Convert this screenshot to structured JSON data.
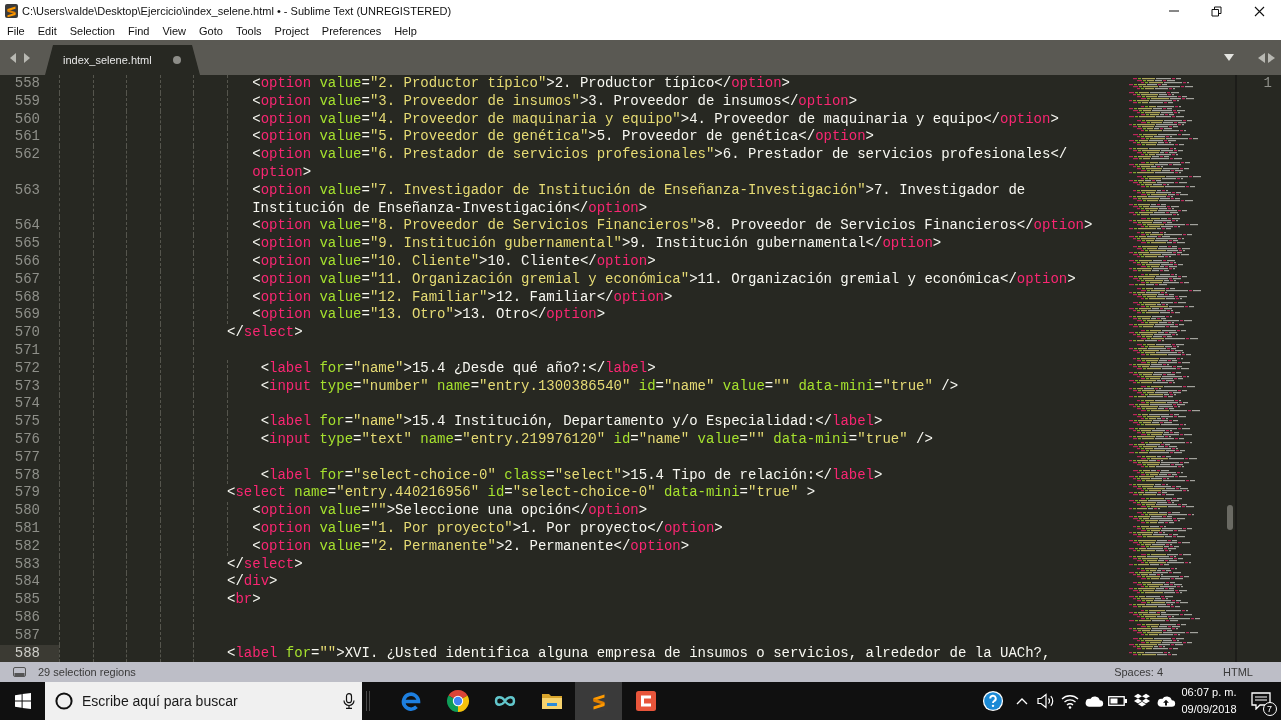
{
  "window": {
    "title": "C:\\Users\\valde\\Desktop\\Ejercicio\\index_selene.html • - Sublime Text (UNREGISTERED)"
  },
  "menu": [
    "File",
    "Edit",
    "Selection",
    "Find",
    "View",
    "Goto",
    "Tools",
    "Project",
    "Preferences",
    "Help"
  ],
  "tabs": [
    {
      "label": "index_selene.html",
      "selected": true,
      "modified": true
    }
  ],
  "editor": {
    "lines": [
      {
        "number": "558",
        "current": false,
        "rows": [
          "                       <option value=\"2. Productor típico\">2. Productor típico</option>"
        ]
      },
      {
        "number": "559",
        "current": false,
        "rows": [
          "                       <option value=\"3. Proveedor de insumos\">3. Proveedor de insumos</option>"
        ]
      },
      {
        "number": "560",
        "current": false,
        "rows": [
          "                       <option value=\"4. Proveedor de maquinaria y equipo\">4. Proveedor de maquinaria y equipo</option>"
        ]
      },
      {
        "number": "561",
        "current": false,
        "rows": [
          "                       <option value=\"5. Proveedor de genética\">5. Proveedor de genética</option>"
        ]
      },
      {
        "number": "562",
        "current": false,
        "rows": [
          "                       <option value=\"6. Prestador de servicios profesionales\">6. Prestador de servicios profesionales</",
          "option>"
        ]
      },
      {
        "number": "563",
        "current": false,
        "rows": [
          "                       <option value=\"7. Investigador de Institución de Enseñanza-Investigación\">7. Investigador de",
          "Institución de Enseñanza-Investigación</option>"
        ]
      },
      {
        "number": "564",
        "current": false,
        "rows": [
          "                       <option value=\"8. Proveedor de Servicios Financieros\">8. Proveedor de Servicios Financieros</option>"
        ]
      },
      {
        "number": "565",
        "current": false,
        "rows": [
          "                       <option value=\"9. Institución gubernamental\">9. Institución gubernamental</option>"
        ]
      },
      {
        "number": "566",
        "current": false,
        "rows": [
          "                       <option value=\"10. Cliente\">10. Cliente</option>"
        ]
      },
      {
        "number": "567",
        "current": false,
        "rows": [
          "                       <option value=\"11. Organización gremial y económica\">11. Organización gremial y económica</option>"
        ]
      },
      {
        "number": "568",
        "current": false,
        "rows": [
          "                       <option value=\"12. Familiar\">12. Familiar</option>"
        ]
      },
      {
        "number": "569",
        "current": false,
        "rows": [
          "                       <option value=\"13. Otro\">13. Otro</option>"
        ]
      },
      {
        "number": "570",
        "current": false,
        "rows": [
          "                    </select>"
        ]
      },
      {
        "number": "571",
        "current": false
      },
      {
        "number": "572",
        "current": false,
        "rows": [
          "                        <label for=\"name\">15.4 ¿Desde qué año?:</label>"
        ]
      },
      {
        "number": "573",
        "current": false,
        "rows": [
          "                        <input type=\"number\" name=\"entry.1300386540\" id=\"name\" value=\"\" data-mini=\"true\" />"
        ]
      },
      {
        "number": "574",
        "current": false
      },
      {
        "number": "575",
        "current": false,
        "rows": [
          "                        <label for=\"name\">15.4 Institución, Departamento y/o Especialidad:</label>"
        ]
      },
      {
        "number": "576",
        "current": false,
        "rows": [
          "                        <input type=\"text\" name=\"entry.219976120\" id=\"name\" value=\"\" data-mini=\"true\" />"
        ]
      },
      {
        "number": "577",
        "current": false
      },
      {
        "number": "578",
        "current": false,
        "rows": [
          "                        <label for=\"select-choice-0\" class=\"select\">15.4 Tipo de relación:</label>"
        ]
      },
      {
        "number": "579",
        "current": false,
        "rows": [
          "                    <select name=\"entry.440216956\" id=\"select-choice-0\" data-mini=\"true\" >"
        ]
      },
      {
        "number": "580",
        "current": false,
        "rows": [
          "                       <option value=\"\">Seleccione una opción</option>"
        ]
      },
      {
        "number": "581",
        "current": false,
        "rows": [
          "                       <option value=\"1. Por proyecto\">1. Por proyecto</option>"
        ]
      },
      {
        "number": "582",
        "current": false,
        "rows": [
          "                       <option value=\"2. Permanente\">2. Permanente</option>"
        ]
      },
      {
        "number": "583",
        "current": false,
        "rows": [
          "                    </select>"
        ]
      },
      {
        "number": "584",
        "current": false,
        "rows": [
          "                    </div>"
        ]
      },
      {
        "number": "585",
        "current": false,
        "rows": [
          "                    <br>"
        ]
      },
      {
        "number": "586",
        "current": false
      },
      {
        "number": "587",
        "current": false
      },
      {
        "number": "588",
        "current": true,
        "rows": [
          "                    <label for=\"\">XVI. ¿Usted identifica alguna empresa de insumos o servicios, alrededor de la UACh?,"
        ]
      }
    ]
  },
  "second_pane": {
    "line_numbers": [
      "1"
    ]
  },
  "status_bar": {
    "message": "29 selection regions",
    "indentation": "Spaces: 4",
    "syntax": "HTML"
  },
  "taskbar": {
    "search": {
      "placeholder": "Escribe aquí para buscar"
    },
    "apps": [
      {
        "active": false
      },
      {
        "active": false
      },
      {
        "active": false
      },
      {
        "active": false
      },
      {
        "active": true
      },
      {
        "active": false
      }
    ],
    "clock": {
      "time": "06:07 p. m.",
      "date": "09/09/2018"
    },
    "notification_count": "7"
  }
}
